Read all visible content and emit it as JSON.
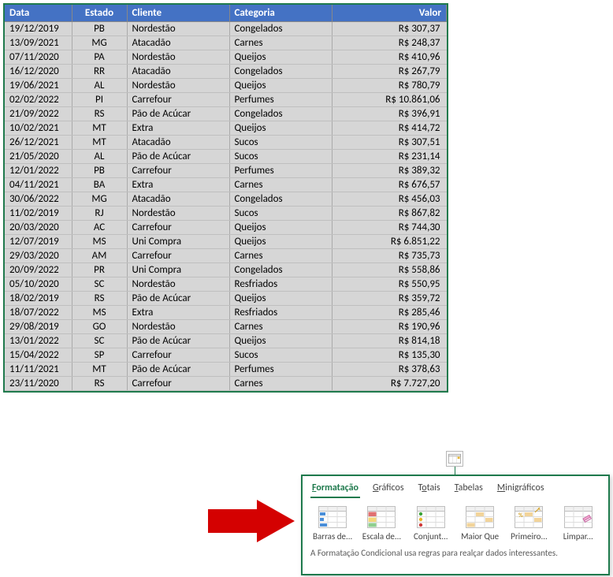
{
  "table": {
    "headers": [
      "Data",
      "Estado",
      "Cliente",
      "Categoria",
      "Valor"
    ],
    "rows": [
      [
        "19/12/2019",
        "PB",
        "Nordestão",
        "Congelados",
        "R$ 307,37"
      ],
      [
        "13/09/2021",
        "MG",
        "Atacadão",
        "Carnes",
        "R$ 248,37"
      ],
      [
        "07/11/2020",
        "PA",
        "Nordestão",
        "Queijos",
        "R$ 410,96"
      ],
      [
        "16/12/2020",
        "RR",
        "Atacadão",
        "Congelados",
        "R$ 267,79"
      ],
      [
        "19/06/2021",
        "AL",
        "Nordestão",
        "Queijos",
        "R$ 780,79"
      ],
      [
        "02/02/2022",
        "PI",
        "Carrefour",
        "Perfumes",
        "R$ 10.861,06"
      ],
      [
        "21/09/2022",
        "RS",
        "Pão de Acúcar",
        "Congelados",
        "R$ 396,91"
      ],
      [
        "10/02/2021",
        "MT",
        "Extra",
        "Queijos",
        "R$ 414,72"
      ],
      [
        "26/12/2021",
        "MT",
        "Atacadão",
        "Sucos",
        "R$ 307,51"
      ],
      [
        "21/05/2020",
        "AL",
        "Pão de Acúcar",
        "Sucos",
        "R$ 231,14"
      ],
      [
        "12/01/2022",
        "PB",
        "Carrefour",
        "Perfumes",
        "R$ 389,32"
      ],
      [
        "04/11/2021",
        "BA",
        "Extra",
        "Carnes",
        "R$ 676,57"
      ],
      [
        "30/06/2022",
        "MG",
        "Atacadão",
        "Congelados",
        "R$ 456,03"
      ],
      [
        "11/02/2019",
        "RJ",
        "Nordestão",
        "Sucos",
        "R$ 867,82"
      ],
      [
        "20/03/2020",
        "AC",
        "Carrefour",
        "Queijos",
        "R$ 744,30"
      ],
      [
        "12/07/2019",
        "MS",
        "Uni Compra",
        "Queijos",
        "R$ 6.851,22"
      ],
      [
        "29/03/2020",
        "AM",
        "Carrefour",
        "Carnes",
        "R$ 735,73"
      ],
      [
        "20/09/2022",
        "PR",
        "Uni Compra",
        "Congelados",
        "R$ 558,86"
      ],
      [
        "05/10/2020",
        "SC",
        "Nordestão",
        "Resfriados",
        "R$ 550,95"
      ],
      [
        "18/02/2019",
        "RS",
        "Pão de Acúcar",
        "Queijos",
        "R$ 359,72"
      ],
      [
        "18/07/2022",
        "MS",
        "Extra",
        "Resfriados",
        "R$ 285,46"
      ],
      [
        "29/08/2019",
        "GO",
        "Nordestão",
        "Carnes",
        "R$ 190,96"
      ],
      [
        "13/01/2022",
        "SC",
        "Pão de Acúcar",
        "Queijos",
        "R$ 814,18"
      ],
      [
        "15/04/2022",
        "SP",
        "Carrefour",
        "Sucos",
        "R$ 135,30"
      ],
      [
        "11/11/2021",
        "MT",
        "Pão de Acúcar",
        "Perfumes",
        "R$ 378,63"
      ],
      [
        "23/11/2020",
        "RS",
        "Carrefour",
        "Carnes",
        "R$ 7.727,20"
      ]
    ]
  },
  "popup": {
    "tabs": {
      "formatting": "Formatação",
      "charts": "Gráficos",
      "totals": "Totais",
      "tables": "Tabelas",
      "sparklines": "Minigráficos"
    },
    "options": {
      "data_bars": "Barras de...",
      "color_scale": "Escala de...",
      "icon_set": "Conjunt...",
      "greater_than": "Maior Que",
      "top_items": "Primeiro...",
      "clear": "Limpar..."
    },
    "description": "A Formatação Condicional usa regras para realçar dados interessantes."
  }
}
